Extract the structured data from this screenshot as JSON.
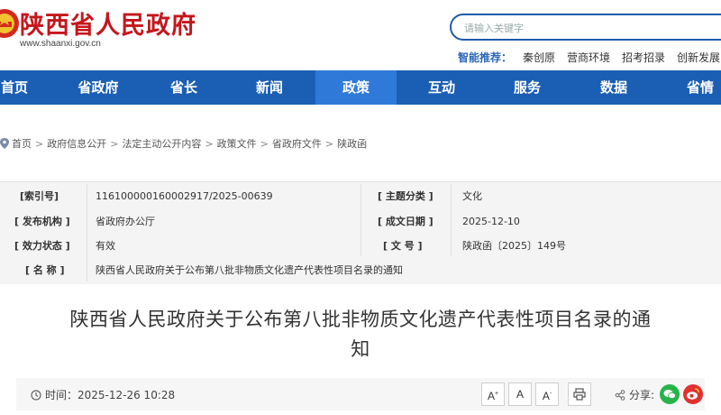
{
  "header": {
    "site_title": "陕西省人民政府",
    "site_url": "www.shaanxi.gov.cn",
    "search_placeholder": "请输入关键字",
    "smart_label": "智能推荐：",
    "smart_links": [
      "秦创原",
      "营商环境",
      "招考招录",
      "创新发展"
    ]
  },
  "nav": {
    "items": [
      "首页",
      "省政府",
      "省长",
      "新闻",
      "政策",
      "互动",
      "服务",
      "数据",
      "省情"
    ],
    "active_index": 4
  },
  "breadcrumb": [
    "首页",
    "政府信息公开",
    "法定主动公开内容",
    "政策文件",
    "省政府文件",
    "陕政函"
  ],
  "info": {
    "index_label": "[索引号]",
    "index_value": "116100000160002917/2025-00639",
    "topic_label": "[ 主题分类 ]",
    "topic_value": "文化",
    "org_label": "[ 发布机构 ]",
    "org_value": "省政府办公厅",
    "date_label": "[ 成文日期 ]",
    "date_value": "2025-12-10",
    "status_label": "[ 效力状态 ]",
    "status_value": "有效",
    "docno_label": "[ 文  号 ]",
    "docno_value": "陕政函〔2025〕149号",
    "name_label": "[ 名  称 ]",
    "name_value": "陕西省人民政府关于公布第八批非物质文化遗产代表性项目名录的通知"
  },
  "article": {
    "title_line1": "陕西省人民政府关于公布第八批非物质文化遗产代表性项目名录的通",
    "title_line2": "知"
  },
  "toolbar": {
    "time": "时间：2025-12-26 10:28",
    "font_large": "A",
    "font_medium": "A",
    "font_small": "A",
    "share_label": "分享:"
  },
  "colors": {
    "brand_red": "#c4161c",
    "nav_blue": "#1b5fb4",
    "nav_active": "#2f7ad8",
    "wechat_green": "#28b34a",
    "weibo_red": "#e0312f"
  }
}
